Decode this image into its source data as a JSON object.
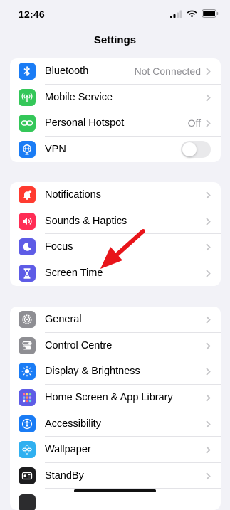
{
  "status_bar": {
    "time": "12:46"
  },
  "nav": {
    "title": "Settings"
  },
  "group1": [
    {
      "label": "Bluetooth",
      "value": "Not Connected",
      "icon": "bluetooth-icon",
      "color": "#1a7cf5"
    },
    {
      "label": "Mobile Service",
      "value": "",
      "icon": "antenna-icon",
      "color": "#34c759"
    },
    {
      "label": "Personal Hotspot",
      "value": "Off",
      "icon": "hotspot-icon",
      "color": "#34c759"
    },
    {
      "label": "VPN",
      "value": "",
      "icon": "globe-icon",
      "color": "#1a7cf5",
      "toggle": false
    }
  ],
  "group2": [
    {
      "label": "Notifications",
      "icon": "bell-icon",
      "color": "#ff3b30"
    },
    {
      "label": "Sounds & Haptics",
      "icon": "speaker-icon",
      "color": "#ff2d55"
    },
    {
      "label": "Focus",
      "icon": "moon-icon",
      "color": "#5e5ce6"
    },
    {
      "label": "Screen Time",
      "icon": "hourglass-icon",
      "color": "#5e5ce6"
    }
  ],
  "group3": [
    {
      "label": "General",
      "icon": "gear-icon",
      "color": "#8e8e93"
    },
    {
      "label": "Control Centre",
      "icon": "switches-icon",
      "color": "#8e8e93"
    },
    {
      "label": "Display & Brightness",
      "icon": "sun-icon",
      "color": "#1a7cf5"
    },
    {
      "label": "Home Screen & App Library",
      "icon": "app-grid-icon",
      "color": "#5e5ce6"
    },
    {
      "label": "Accessibility",
      "icon": "accessibility-icon",
      "color": "#1a7cf5"
    },
    {
      "label": "Wallpaper",
      "icon": "flower-icon",
      "color": "#30b0f0"
    },
    {
      "label": "StandBy",
      "icon": "standby-icon",
      "color": "#1c1c1e"
    }
  ],
  "accent_colors": {
    "arrow": "#e8141a",
    "chevron": "#c4c4c7",
    "secondary_text": "#8e8e93"
  }
}
